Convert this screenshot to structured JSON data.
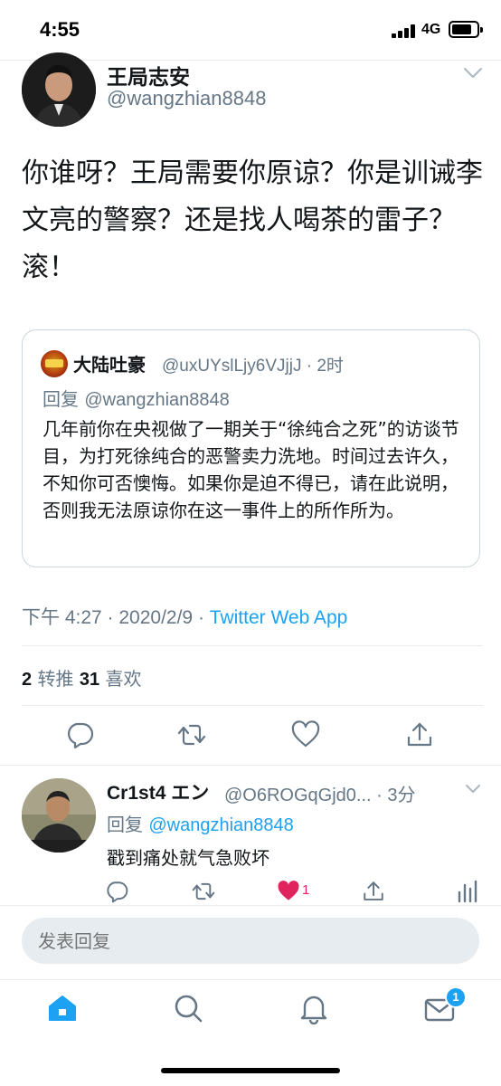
{
  "status_bar": {
    "time": "4:55",
    "network": "4G"
  },
  "tweet": {
    "author_name": "王局志安",
    "author_handle": "@wangzhian8848",
    "text": "你谁呀？王局需要你原谅？你是训诫李文亮的警察？还是找人喝茶的雷子？滚！",
    "meta_time": "下午 4:27 · 2020/2/9 · ",
    "meta_app": "Twitter Web App",
    "retweet_count": "2",
    "retweet_label": " 转推  ",
    "like_count": "31",
    "like_label": " 喜欢"
  },
  "quoted": {
    "name": "大陆吐豪",
    "handle": "@uxUYslLjy6VJjjJ · 2时",
    "reply_prefix": "回复 ",
    "reply_mention": "@wangzhian8848",
    "text": "几年前你在央视做了一期关于“徐纯合之死”的访谈节目，为打死徐纯合的恶警卖力洗地。时间过去许久，不知你可否懊悔。如果你是迫不得已，请在此说明，否则我无法原谅你在这一事件上的所作所为。"
  },
  "reply": {
    "name": "Cr1st4 エン",
    "handle": "@O6ROGqGjd0... · 3分",
    "reply_prefix": "回复 ",
    "reply_mention": "@wangzhian8848",
    "text": "戳到痛处就气急败坏",
    "like_count": "1"
  },
  "compose": {
    "placeholder": "发表回复"
  },
  "tab_bar": {
    "items": [
      "home-icon",
      "search-icon",
      "notifications-icon",
      "messages-icon"
    ],
    "messages_badge": "1"
  },
  "colors": {
    "accent": "#1da1f2",
    "muted": "#657786",
    "like": "#e0245e",
    "text": "#14171a"
  }
}
